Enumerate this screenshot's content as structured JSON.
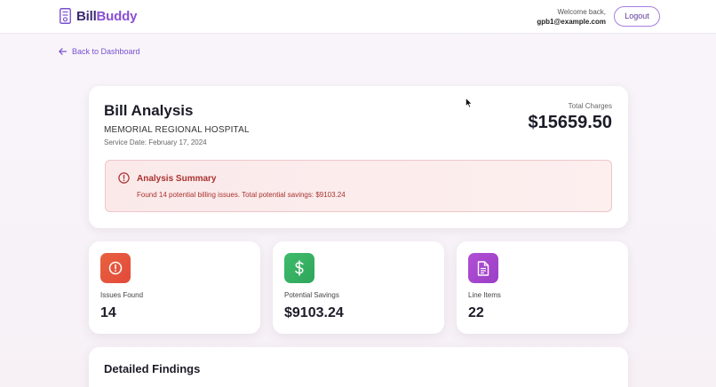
{
  "header": {
    "logo_part1": "Bill",
    "logo_part2": "Buddy",
    "welcome_text": "Welcome back,",
    "user_email": "gpb1@example.com",
    "logout_label": "Logout"
  },
  "nav": {
    "back_label": "Back to Dashboard"
  },
  "analysis": {
    "title": "Bill Analysis",
    "provider": "MEMORIAL REGIONAL HOSPITAL",
    "service_date": "Service Date: February 17, 2024",
    "total_label": "Total Charges",
    "total_value": "$15659.50",
    "summary_title": "Analysis Summary",
    "summary_text": "Found 14 potential billing issues. Total potential savings: $9103.24"
  },
  "stats": [
    {
      "label": "Issues Found",
      "value": "14",
      "icon": "alert-circle-icon",
      "color_from": "#e8613f",
      "color_to": "#e24a3b"
    },
    {
      "label": "Potential Savings",
      "value": "$9103.24",
      "icon": "dollar-icon",
      "color_from": "#3fbb6c",
      "color_to": "#2fa65b"
    },
    {
      "label": "Line Items",
      "value": "22",
      "icon": "document-icon",
      "color_from": "#b14fd3",
      "color_to": "#9a3fc8"
    }
  ],
  "findings": {
    "title": "Detailed Findings"
  },
  "colors": {
    "brand_purple": "#8a4fd6",
    "brand_dark": "#3b2a70",
    "alert_red": "#a8332f"
  }
}
